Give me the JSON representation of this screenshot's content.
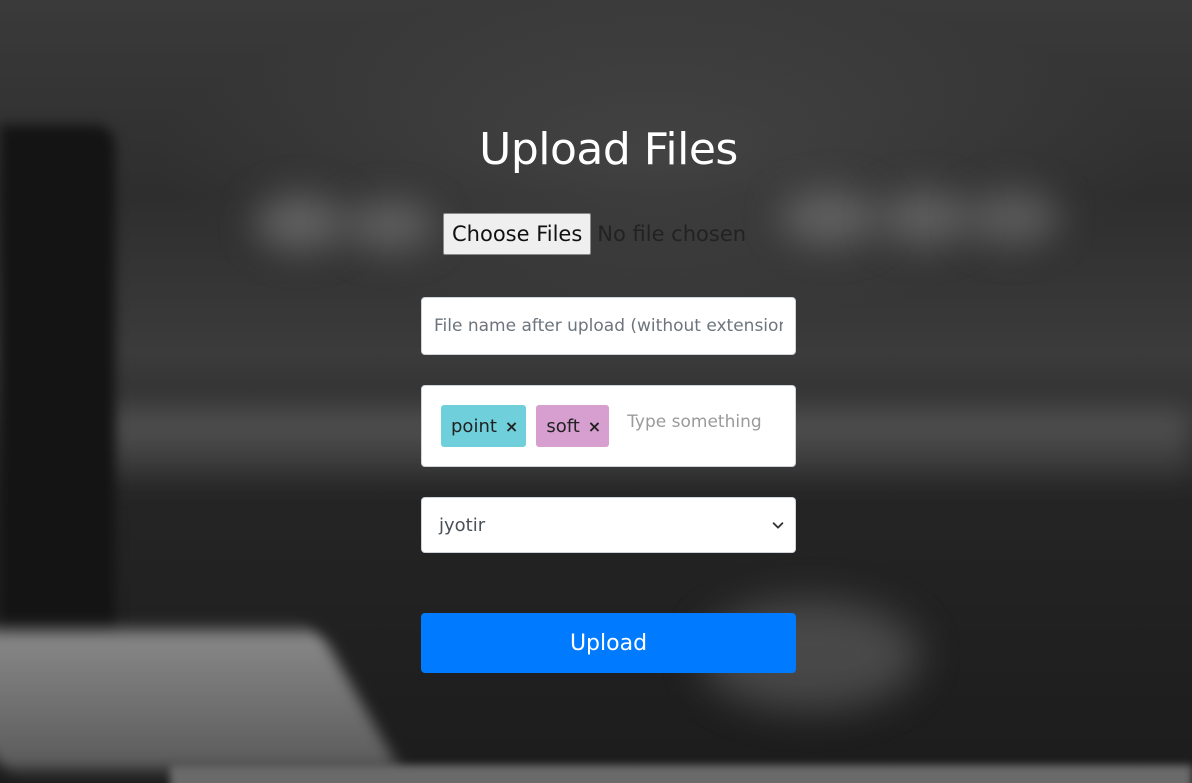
{
  "page": {
    "title": "Upload Files"
  },
  "file_input": {
    "button_label": "Choose Files",
    "status": "No file chosen"
  },
  "filename_input": {
    "value": "",
    "placeholder": "File name after upload (without extension)"
  },
  "tags": {
    "items": [
      {
        "label": "point",
        "remove": "×",
        "color": "#6fd0dc"
      },
      {
        "label": "soft",
        "remove": "×",
        "color": "#d79fcf"
      }
    ],
    "placeholder": "Type something"
  },
  "select": {
    "selected": "jyotir",
    "icon": "chevron-down-icon"
  },
  "upload_button": {
    "label": "Upload",
    "color": "#007bff"
  }
}
